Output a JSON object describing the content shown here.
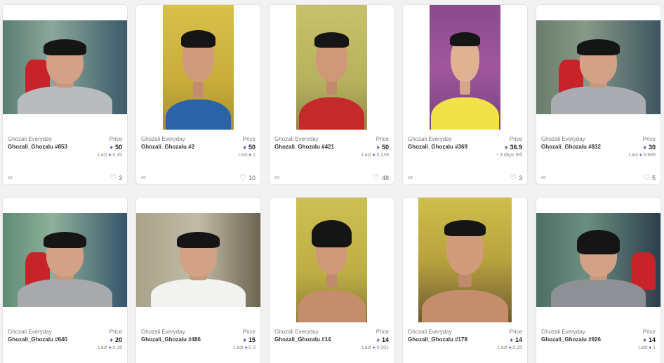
{
  "price_label": "Price",
  "cards": [
    {
      "collection": "Ghozali Everyday",
      "token": "Ghozali_Ghozalu #853",
      "price": "50",
      "last_label": "Last",
      "last_value": "0.45",
      "likes": "3",
      "icon": "ethereum-icon"
    },
    {
      "collection": "Ghozali Everyday",
      "token": "Ghozali_Ghozalu #2",
      "price": "50",
      "last_label": "Last",
      "last_value": "1",
      "likes": "10",
      "icon": "ethereum-icon"
    },
    {
      "collection": "Ghozali Everyday",
      "token": "Ghozali_Ghozalu #421",
      "price": "50",
      "last_label": "Last",
      "last_value": "0.249",
      "likes": "48",
      "icon": "ethereum-icon"
    },
    {
      "collection": "Ghozali Everyday",
      "token": "Ghozali_Ghozalu #369",
      "price": "36.9",
      "last_label": "3 days left",
      "last_value": "",
      "likes": "3",
      "icon": "clock-icon"
    },
    {
      "collection": "Ghozali Everyday",
      "token": "Ghozali_Ghozalu #832",
      "price": "30",
      "last_label": "Last",
      "last_value": "0.989",
      "likes": "5",
      "icon": "ethereum-icon"
    },
    {
      "collection": "Ghozali Everyday",
      "token": "Ghozali_Ghozalu #640",
      "price": "20",
      "last_label": "Last",
      "last_value": "0.16",
      "likes": "",
      "icon": "ethereum-icon"
    },
    {
      "collection": "Ghozali Everyday",
      "token": "Ghozali_Ghozalu #486",
      "price": "15",
      "last_label": "Last",
      "last_value": "0.3",
      "likes": "",
      "icon": "ethereum-icon"
    },
    {
      "collection": "Ghozali Everyday",
      "token": "Ghozali_Ghozalu #14",
      "price": "14",
      "last_label": "Last",
      "last_value": "0.001",
      "likes": "",
      "icon": "ethereum-icon"
    },
    {
      "collection": "Ghozali Everyday",
      "token": "Ghozali_Ghozalu #178",
      "price": "14",
      "last_label": "Last",
      "last_value": "0.25",
      "likes": "",
      "icon": "ethereum-icon"
    },
    {
      "collection": "Ghozali Everyday",
      "token": "Ghozali_Ghozalu #926",
      "price": "14",
      "last_label": "Last",
      "last_value": "1",
      "likes": "",
      "icon": "ethereum-icon"
    }
  ],
  "colors": {
    "eth": "#6b5cc9",
    "card_bg": "#ffffff",
    "page_bg": "#f2f2f2"
  }
}
